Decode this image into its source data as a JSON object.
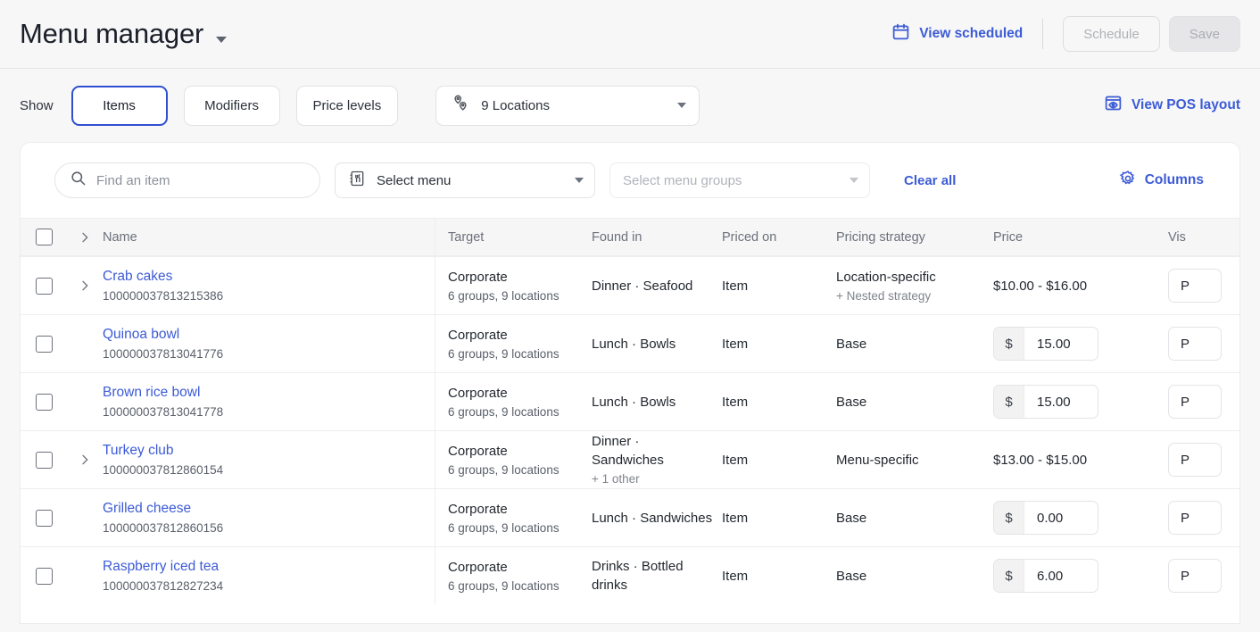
{
  "header": {
    "title": "Menu manager",
    "title_caret_icon": "chevron-down-icon",
    "view_scheduled_label": "View scheduled",
    "view_scheduled_icon": "calendar-icon",
    "schedule_label": "Schedule",
    "save_label": "Save",
    "link_color": "#3c5bd6"
  },
  "toolbar": {
    "show_label": "Show",
    "segments": [
      {
        "label": "Items",
        "active": true
      },
      {
        "label": "Modifiers",
        "active": false
      },
      {
        "label": "Price levels",
        "active": false
      }
    ],
    "locations_value": "9 Locations",
    "locations_icon": "map-pin-icon",
    "view_pos_label": "View POS layout",
    "view_pos_icon": "pos-eye-icon",
    "active_border_color": "#2f4fd0"
  },
  "filters": {
    "search_placeholder": "Find an item",
    "search_value": "",
    "search_icon": "search-icon",
    "menu_select_value": "Select menu",
    "menu_select_icon": "menu-book-icon",
    "menu_groups_placeholder": "Select menu groups",
    "clear_all_label": "Clear all",
    "columns_label": "Columns",
    "columns_icon": "gear-icon"
  },
  "table": {
    "columns": {
      "name": "Name",
      "target": "Target",
      "found_in": "Found in",
      "priced_on": "Priced on",
      "pricing_strategy": "Pricing strategy",
      "price": "Price",
      "visibility": "Vis"
    },
    "rows": [
      {
        "name": "Crab cakes",
        "id": "100000037813215386",
        "expandable": true,
        "target": "Corporate",
        "target_sub": "6 groups, 9 locations",
        "found_in": "Dinner · Seafood",
        "found_in_sub": "",
        "priced_on": "Item",
        "strategy": "Location-specific",
        "strategy_sub": "+ Nested strategy",
        "price_type": "range",
        "price_text": "$10.00 - $16.00",
        "price_value": "",
        "visibility": "P"
      },
      {
        "name": "Quinoa bowl",
        "id": "100000037813041776",
        "expandable": false,
        "target": "Corporate",
        "target_sub": "6 groups, 9 locations",
        "found_in": "Lunch · Bowls",
        "found_in_sub": "",
        "priced_on": "Item",
        "strategy": "Base",
        "strategy_sub": "",
        "price_type": "input",
        "price_text": "",
        "price_value": "15.00",
        "visibility": "P"
      },
      {
        "name": "Brown rice bowl",
        "id": "100000037813041778",
        "expandable": false,
        "target": "Corporate",
        "target_sub": "6 groups, 9 locations",
        "found_in": "Lunch · Bowls",
        "found_in_sub": "",
        "priced_on": "Item",
        "strategy": "Base",
        "strategy_sub": "",
        "price_type": "input",
        "price_text": "",
        "price_value": "15.00",
        "visibility": "P"
      },
      {
        "name": "Turkey club",
        "id": "100000037812860154",
        "expandable": true,
        "target": "Corporate",
        "target_sub": "6 groups, 9 locations",
        "found_in": "Dinner · Sandwiches",
        "found_in_sub": "+ 1 other",
        "priced_on": "Item",
        "strategy": "Menu-specific",
        "strategy_sub": "",
        "price_type": "range",
        "price_text": "$13.00 - $15.00",
        "price_value": "",
        "visibility": "P"
      },
      {
        "name": "Grilled cheese",
        "id": "100000037812860156",
        "expandable": false,
        "target": "Corporate",
        "target_sub": "6 groups, 9 locations",
        "found_in": "Lunch · Sandwiches",
        "found_in_sub": "",
        "priced_on": "Item",
        "strategy": "Base",
        "strategy_sub": "",
        "price_type": "input",
        "price_text": "",
        "price_value": "0.00",
        "visibility": "P"
      },
      {
        "name": "Raspberry iced tea",
        "id": "100000037812827234",
        "expandable": false,
        "target": "Corporate",
        "target_sub": "6 groups, 9 locations",
        "found_in": "Drinks · Bottled drinks",
        "found_in_sub": "",
        "priced_on": "Item",
        "strategy": "Base",
        "strategy_sub": "",
        "price_type": "input",
        "price_text": "",
        "price_value": "6.00",
        "visibility": "P"
      }
    ],
    "currency_symbol": "$"
  }
}
